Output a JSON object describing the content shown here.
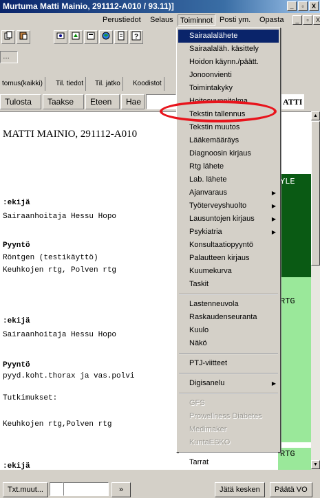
{
  "window": {
    "title": "Murtuma Matti Mainio, 291112-A010 / 93.11)]",
    "controls": [
      "_",
      "▫",
      "X"
    ],
    "inner_controls": [
      "_",
      "▫",
      "X"
    ]
  },
  "menubar": {
    "items": [
      "Perustiedot",
      "Selaus",
      "Toiminnot",
      "Posti ym.",
      "Opasta"
    ]
  },
  "tabs": [
    "tomus(kaikki)",
    "Til. tiedot",
    "Til. jatko",
    "Koodistot"
  ],
  "nav": {
    "buttons": [
      "Tulosta",
      "Taakse",
      "Eteen",
      "Hae"
    ],
    "name_tail": "ATTI"
  },
  "document": {
    "heading": "MATTI MAINIO, 291112-A010",
    "lines": [
      ":ekijä",
      "Sairaanhoitaja Hessu Hopo",
      "Pyyntö",
      "Röntgen (testikäyttö)",
      "Keuhkojen rtg, Polven rtg",
      ":ekijä",
      "Sairaanhoitaja Hessu Hopo",
      "Pyyntö",
      "pyyd.koht.thorax ja vas.polvi",
      "Tutkimukset:",
      "Keuhkojen rtg,Polven rtg",
      ":ekijä"
    ],
    "column_labels": [
      "YLE",
      "RTG",
      "RTG"
    ]
  },
  "dropdown": {
    "items": [
      {
        "label": "Sairaalalähete",
        "state": "selected"
      },
      {
        "label": "Sairaalaläh. käsittely"
      },
      {
        "label": "Hoidon käynn./päätt."
      },
      {
        "label": "Jonoonvienti"
      },
      {
        "label": "Toimintakyky"
      },
      {
        "label": "Hoitosuunnitelma"
      },
      {
        "label": "Tekstin tallennus"
      },
      {
        "label": "Tekstin muutos"
      },
      {
        "label": "Lääkemääräys"
      },
      {
        "label": "Diagnoosin kirjaus"
      },
      {
        "label": "Rtg lähete"
      },
      {
        "label": "Lab. lähete"
      },
      {
        "label": "Ajanvaraus",
        "submenu": true
      },
      {
        "label": "Työterveyshuolto",
        "submenu": true
      },
      {
        "label": "Lausuntojen kirjaus",
        "submenu": true
      },
      {
        "label": "Psykiatria",
        "submenu": true
      },
      {
        "label": "Konsultaatiopyyntö"
      },
      {
        "label": "Palautteen kirjaus"
      },
      {
        "label": "Kuumekurva"
      },
      {
        "label": "Taskit"
      },
      {
        "label": "Lastenneuvola"
      },
      {
        "label": "Raskaudenseuranta"
      },
      {
        "label": "Kuulo"
      },
      {
        "label": "Näkö"
      },
      {
        "label": "PTJ-viitteet"
      },
      {
        "label": "Digisanelu",
        "submenu": true
      },
      {
        "label": "GFS",
        "state": "disabled"
      },
      {
        "label": "Prowellness Diabetes",
        "state": "disabled"
      },
      {
        "label": "Medimaker",
        "state": "disabled"
      },
      {
        "label": "KuntaESKO",
        "state": "disabled"
      },
      {
        "label": "Tarrat"
      }
    ]
  },
  "statusbar": {
    "left_button": "Txt.muut...",
    "nav_button": "»",
    "right_buttons": [
      "Jätä kesken",
      "Päätä VO"
    ]
  },
  "colors": {
    "selection": "#0a246a",
    "highlight_ellipse": "#e8141c",
    "green_dark": "#0a5a14",
    "green_light": "#9ae89a"
  }
}
